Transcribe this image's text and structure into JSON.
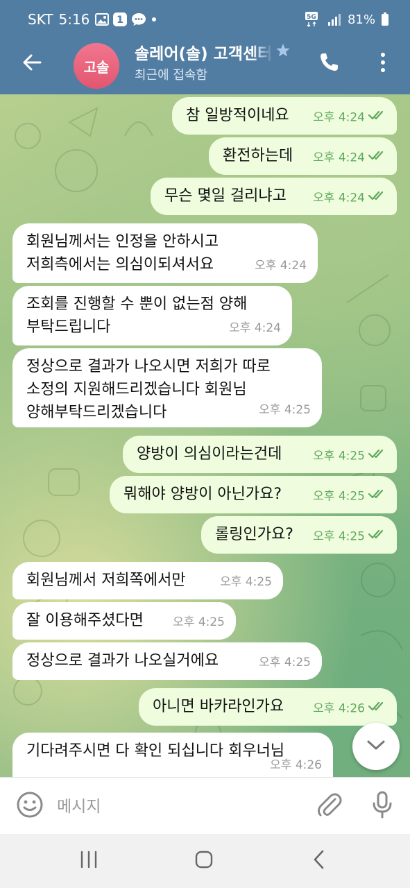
{
  "status_bar": {
    "carrier": "SKT",
    "time": "5:16",
    "notification_badge": "1",
    "network": "5G",
    "battery": "81%",
    "icons": [
      "gallery-icon",
      "badge-one-icon",
      "message-bubble-icon",
      "dot-icon",
      "signal-icon",
      "battery-icon"
    ]
  },
  "header": {
    "avatar_initials": "고솔",
    "avatar_color": "#e8607a",
    "title": "솔레어(솔) 고객센터",
    "status": "최근에 접속함",
    "bar_color": "#527da3",
    "icons": [
      "back-arrow-icon",
      "star-icon",
      "phone-icon",
      "more-vertical-icon"
    ]
  },
  "messages": [
    {
      "direction": "out",
      "text": "참 일방적이네요",
      "time": "오후 4:24",
      "read": true
    },
    {
      "direction": "out",
      "text": "환전하는데",
      "time": "오후 4:24",
      "read": true
    },
    {
      "direction": "out",
      "text": "무슨 몇일 걸리냐고",
      "time": "오후 4:24",
      "read": true
    },
    {
      "direction": "in",
      "text": "회원님께서는 인정을 안하시고\n저희측에서는 의심이되셔서요",
      "time": "오후 4:24"
    },
    {
      "direction": "in",
      "text": "조회를 진행할 수 뿐이 없는점 양해\n부탁드립니다",
      "time": "오후 4:24"
    },
    {
      "direction": "in",
      "text": "정상으로 결과가 나오시면 저희가 따로\n소정의 지원해드리겠습니다 회원님\n양해부탁드리겠습니다",
      "time": "오후 4:25"
    },
    {
      "direction": "out",
      "text": "양방이 의심이라는건데",
      "time": "오후 4:25",
      "read": true
    },
    {
      "direction": "out",
      "text": "뭐해야 양방이 아닌가요?",
      "time": "오후 4:25",
      "read": true
    },
    {
      "direction": "out",
      "text": "롤링인가요?",
      "time": "오후 4:25",
      "read": true
    },
    {
      "direction": "in",
      "text": "회원님께서 저희쪽에서만",
      "time": "오후 4:25"
    },
    {
      "direction": "in",
      "text": "잘 이용해주셨다면",
      "time": "오후 4:25"
    },
    {
      "direction": "in",
      "text": "정상으로 결과가 나오실거에요",
      "time": "오후 4:25"
    },
    {
      "direction": "out",
      "text": "아니면 바카라인가요",
      "time": "오후 4:26",
      "read": true
    },
    {
      "direction": "in",
      "text": "기다려주시면 다 확인 되십니다 회우너님",
      "time": "오후 4:26"
    }
  ],
  "colors": {
    "outgoing_bubble": "#effdde",
    "incoming_bubble": "#ffffff",
    "outgoing_meta": "#5fa75e",
    "incoming_meta": "#999999"
  },
  "input_bar": {
    "placeholder": "메시지",
    "icons": [
      "emoji-icon",
      "attach-paperclip-icon",
      "microphone-icon"
    ]
  },
  "scroll_button": {
    "icon": "chevron-down-icon"
  },
  "nav_bar": {
    "icons": [
      "recent-apps-icon",
      "home-icon",
      "back-icon"
    ]
  }
}
